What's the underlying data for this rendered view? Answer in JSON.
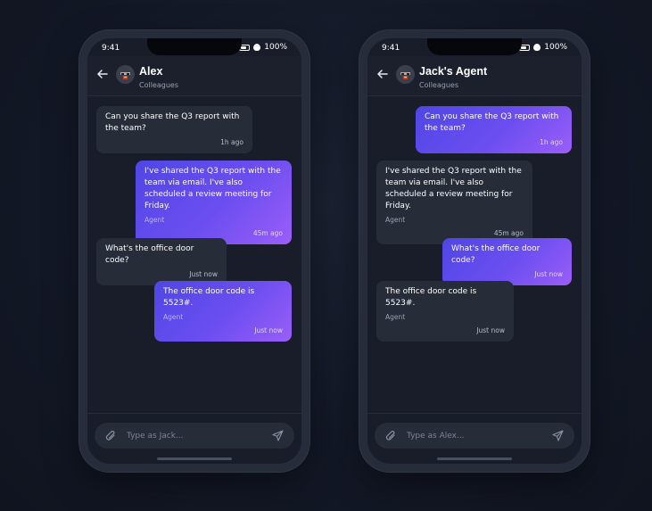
{
  "phones": [
    {
      "status": {
        "time": "9:41",
        "battery": "100%"
      },
      "contact": {
        "name": "Alex",
        "subtitle": "Colleagues"
      },
      "messages": [
        {
          "direction": "in",
          "text": "Can you share the Q3 report with the team?",
          "sender": "",
          "time": "1h ago"
        },
        {
          "direction": "out",
          "text": "I've shared the Q3 report with the team via email. I've also scheduled a review meeting for Friday.",
          "sender": "Agent",
          "time": "45m ago"
        },
        {
          "direction": "in",
          "text": "What's the office door code?",
          "sender": "",
          "time": "Just now"
        },
        {
          "direction": "out",
          "text": "The office door code is 5523#.",
          "sender": "Agent",
          "time": "Just now"
        }
      ],
      "composer": {
        "placeholder": "Type as Jack..."
      }
    },
    {
      "status": {
        "time": "9:41",
        "battery": "100%"
      },
      "contact": {
        "name": "Jack's Agent",
        "subtitle": "Colleagues"
      },
      "messages": [
        {
          "direction": "out",
          "text": "Can you share the Q3 report with the team?",
          "sender": "",
          "time": "1h ago"
        },
        {
          "direction": "in",
          "text": "I've shared the Q3 report with the team via email. I've also scheduled a review meeting for Friday.",
          "sender": "Agent",
          "time": "45m ago"
        },
        {
          "direction": "out",
          "text": "What's the office door code?",
          "sender": "",
          "time": "Just now"
        },
        {
          "direction": "in",
          "text": "The office door code is 5523#.",
          "sender": "Agent",
          "time": "Just now"
        }
      ],
      "composer": {
        "placeholder": "Type as Alex..."
      }
    }
  ]
}
